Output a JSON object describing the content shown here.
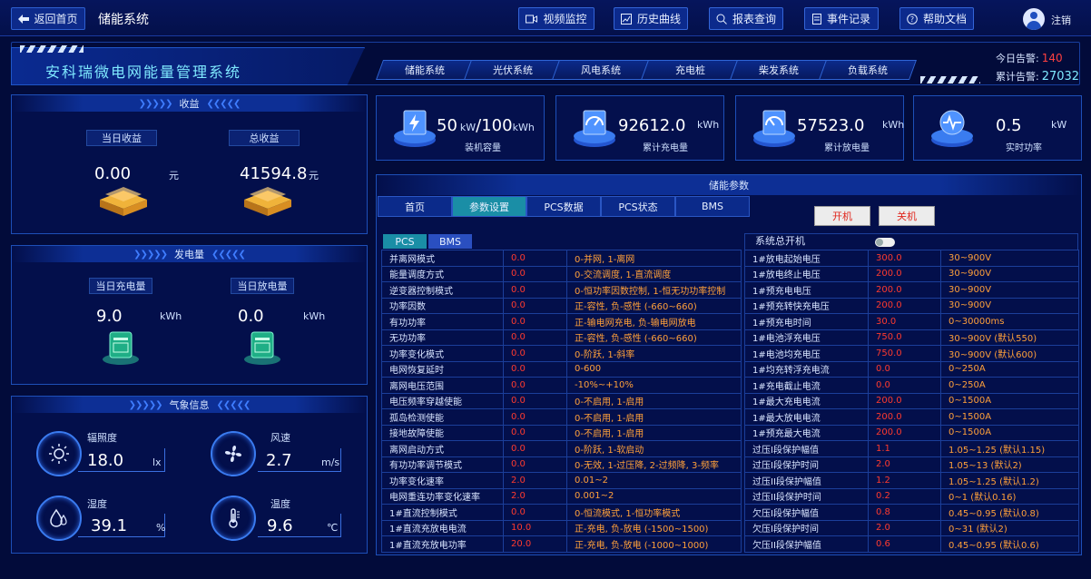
{
  "nav": {
    "back_label": "返回首页",
    "system_title": "储能系统",
    "buttons": [
      "视频监控",
      "历史曲线",
      "报表查询",
      "事件记录",
      "帮助文档"
    ],
    "logout": "注销"
  },
  "header": {
    "brand_title": "安科瑞微电网能量管理系统",
    "tabs": [
      "储能系统",
      "光伏系统",
      "风电系统",
      "充电桩",
      "柴发系统",
      "负载系统"
    ],
    "alarm_today_label": "今日告警:",
    "alarm_today_value": "140",
    "alarm_total_label": "累计告警:",
    "alarm_total_value": "27032"
  },
  "income": {
    "title": "收益",
    "today_label": "当日收益",
    "today_value": "0.00",
    "today_unit": "元",
    "total_label": "总收益",
    "total_value": "41594.8",
    "total_unit": "元"
  },
  "energy": {
    "title": "发电量",
    "charge_label": "当日充电量",
    "charge_value": "9.0",
    "charge_unit": "kWh",
    "discharge_label": "当日放电量",
    "discharge_value": "0.0",
    "discharge_unit": "kWh"
  },
  "weather": {
    "title": "气象信息",
    "items": [
      {
        "name": "辐照度",
        "value": "18.0",
        "unit": "lx",
        "icon": "sun-icon"
      },
      {
        "name": "风速",
        "value": "2.7",
        "unit": "m/s",
        "icon": "fan-icon"
      },
      {
        "name": "湿度",
        "value": "39.1",
        "unit": "%",
        "icon": "humidity-icon"
      },
      {
        "name": "温度",
        "value": "9.6",
        "unit": "℃",
        "icon": "thermometer-icon"
      }
    ]
  },
  "stats": [
    {
      "value": "50",
      "value_unit_inline": "kW",
      "value2": "/100",
      "value2_unit": "kWh",
      "unit": "",
      "label": "装机容量",
      "icon": "battery-bolt-icon"
    },
    {
      "value": "92612.0",
      "unit": "kWh",
      "label": "累计充电量",
      "icon": "gauge-icon"
    },
    {
      "value": "57523.0",
      "unit": "kWh",
      "label": "累计放电量",
      "icon": "gauge-icon"
    },
    {
      "value": "0.5",
      "unit": "kW",
      "label": "实时功率",
      "icon": "pulse-icon"
    }
  ],
  "param_panel": {
    "title": "储能参数",
    "tabs": [
      "首页",
      "参数设置",
      "PCS数据",
      "PCS状态",
      "BMS"
    ],
    "active_tab": "参数设置",
    "sub_tabs": [
      "PCS",
      "BMS"
    ],
    "active_sub_tab": "PCS",
    "on_label": "开机",
    "off_label": "关机",
    "master_switch_label": "系统总开机"
  },
  "pcs_rows": [
    [
      "并离网模式",
      "0.0",
      "0-并网, 1-离网"
    ],
    [
      "能量调度方式",
      "0.0",
      "0-交流调度, 1-直流调度"
    ],
    [
      "逆变器控制模式",
      "0.0",
      "0-恒功率因数控制, 1-恒无功功率控制"
    ],
    [
      "功率因数",
      "0.0",
      "正-容性, 负-感性 (-660~660)"
    ],
    [
      "有功功率",
      "0.0",
      "正-输电网充电, 负-输电网放电"
    ],
    [
      "无功功率",
      "0.0",
      "正-容性, 负-感性 (-660~660)"
    ],
    [
      "功率变化模式",
      "0.0",
      "0-阶跃, 1-斜率"
    ],
    [
      "电网恢复延时",
      "0.0",
      "0-600"
    ],
    [
      "离网电压范围",
      "0.0",
      "-10%~+10%"
    ],
    [
      "电压频率穿越使能",
      "0.0",
      "0-不启用, 1-启用"
    ],
    [
      "孤岛检测使能",
      "0.0",
      "0-不启用, 1-启用"
    ],
    [
      "接地故障使能",
      "0.0",
      "0-不启用, 1-启用"
    ],
    [
      "离网启动方式",
      "0.0",
      "0-阶跃, 1-软启动"
    ],
    [
      "有功功率调节模式",
      "0.0",
      "0-无效, 1-过压降, 2-过频降, 3-频率"
    ],
    [
      "功率变化速率",
      "2.0",
      "0.01~2"
    ],
    [
      "电网重连功率变化速率",
      "2.0",
      "0.001~2"
    ],
    [
      "1#直流控制模式",
      "0.0",
      "0-恒流模式, 1-恒功率模式"
    ],
    [
      "1#直流充放电电流",
      "10.0",
      "正-充电, 负-放电 (-1500~1500)"
    ],
    [
      "1#直流充放电功率",
      "20.0",
      "正-充电, 负-放电 (-1000~1000)"
    ]
  ],
  "bms_rows": [
    [
      "1#放电起始电压",
      "300.0",
      "30~900V"
    ],
    [
      "1#放电终止电压",
      "200.0",
      "30~900V"
    ],
    [
      "1#预充电电压",
      "200.0",
      "30~900V"
    ],
    [
      "1#预充转快充电压",
      "200.0",
      "30~900V"
    ],
    [
      "1#预充电时间",
      "30.0",
      "0~30000ms"
    ],
    [
      "1#电池浮充电压",
      "750.0",
      "30~900V (默认550)"
    ],
    [
      "1#电池均充电压",
      "750.0",
      "30~900V (默认600)"
    ],
    [
      "1#均充转浮充电流",
      "0.0",
      "0~250A"
    ],
    [
      "1#充电截止电流",
      "0.0",
      "0~250A"
    ],
    [
      "1#最大充电电流",
      "200.0",
      "0~1500A"
    ],
    [
      "1#最大放电电流",
      "200.0",
      "0~1500A"
    ],
    [
      "1#预充最大电流",
      "200.0",
      "0~1500A"
    ],
    [
      "过压I段保护幅值",
      "1.1",
      "1.05~1.25 (默认1.15)"
    ],
    [
      "过压I段保护时间",
      "2.0",
      "1.05~13 (默认2)"
    ],
    [
      "过压II段保护幅值",
      "1.2",
      "1.05~1.25 (默认1.2)"
    ],
    [
      "过压II段保护时间",
      "0.2",
      "0~1 (默认0.16)"
    ],
    [
      "欠压I段保护幅值",
      "0.8",
      "0.45~0.95 (默认0.8)"
    ],
    [
      "欠压I段保护时间",
      "2.0",
      "0~31 (默认2)"
    ],
    [
      "欠压II段保护幅值",
      "0.6",
      "0.45~0.95 (默认0.6)"
    ]
  ],
  "colors": {
    "bg": "#020b3a",
    "panel_border": "#1d4fb8",
    "accent_cyan": "#7fe9ff",
    "value_red": "#ff3a2e",
    "range_orange": "#ffa03a",
    "alarm_red": "#ff4040",
    "alarm_total": "#7fe9ff"
  }
}
